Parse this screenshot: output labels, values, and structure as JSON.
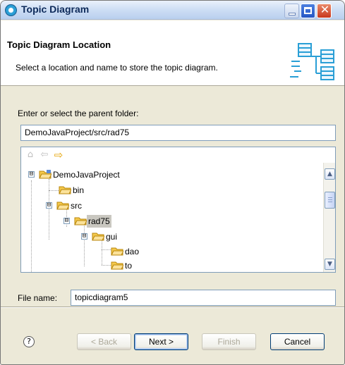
{
  "window": {
    "title": "Topic Diagram",
    "controls": {
      "minimize": "minimize-icon",
      "maximize": "maximize-icon",
      "close": "close-icon"
    }
  },
  "header": {
    "title": "Topic Diagram Location",
    "description": "Select a location and name to store the topic diagram.",
    "graphic": "topic-diagram-wizard-icon"
  },
  "folder": {
    "label": "Enter or select the parent folder:",
    "value": "DemoJavaProject/src/rad75"
  },
  "tree": {
    "toolbar": [
      "home-icon",
      "back-arrow-icon",
      "forward-arrow-icon"
    ],
    "nodes": [
      {
        "label": "DemoJavaProject",
        "expander": "⊟",
        "type": "project"
      },
      {
        "label": "bin",
        "expander": "",
        "type": "folder"
      },
      {
        "label": "src",
        "expander": "⊟",
        "type": "folder"
      },
      {
        "label": "rad75",
        "expander": "⊟",
        "type": "folder",
        "selected": true
      },
      {
        "label": "gui",
        "expander": "⊟",
        "type": "folder"
      },
      {
        "label": "dao",
        "expander": "",
        "type": "folder"
      },
      {
        "label": "to",
        "expander": "",
        "type": "folder"
      }
    ]
  },
  "file": {
    "label": "File name:",
    "value": "topicdiagram5"
  },
  "buttons": {
    "help": "?",
    "back": "< Back",
    "next": "Next >",
    "finish": "Finish",
    "cancel": "Cancel"
  },
  "colors": {
    "dialog_bg": "#ece9d8",
    "selection": "#c9c7c0",
    "folder": "#f5c94c",
    "accent": "#2a9fd6"
  }
}
